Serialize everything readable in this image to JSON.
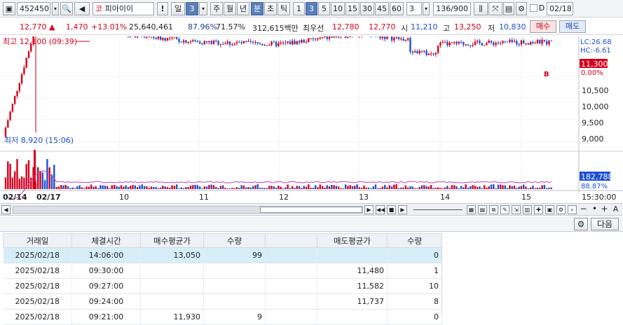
{
  "toolbar": {
    "stock_code": "452450",
    "market_tag": "코",
    "stock_name": "피아이이",
    "alert": "!",
    "period_buttons": [
      "일",
      "3",
      "주",
      "월",
      "년",
      "분",
      "초",
      "틱"
    ],
    "interval_buttons": [
      "1",
      "3",
      "5",
      "10",
      "15",
      "30",
      "45",
      "60"
    ],
    "interval_value": "3",
    "count_display": "136/900",
    "date_value": "02/18",
    "checkbox_label": "D"
  },
  "info": {
    "price": "12,770",
    "change": "1,470",
    "change_pct": "+13.01%",
    "volume": "25,640,461",
    "volume_ratio": "87.96%",
    "turnover": "71.57%",
    "trade_amount": "312,615백만",
    "best_ask_label": "최우선",
    "best_ask": "12,780",
    "best_bid": "12,770",
    "open_label": "시",
    "open": "11,210",
    "high_label": "고",
    "high": "13,250",
    "low_label": "저",
    "low": "10,830",
    "buy_label": "매수",
    "sell_label": "매도"
  },
  "chart": {
    "high_annotation": "최고 12,100 (09:39)",
    "low_annotation": "최저 8,920 (15:06)",
    "lc_label": "LC:26.68",
    "hc_label": "HC:-6.61",
    "price_label": "11,300",
    "pct_label": "0.00%",
    "b_marker": "B",
    "y_ticks": [
      "10,500",
      "10,000",
      "9,500",
      "9,000"
    ],
    "volume_value": "182,788",
    "volume_pct": "88.87%",
    "x_labels": [
      "02/14",
      "02/17",
      "10",
      "11",
      "12",
      "13",
      "14",
      "15"
    ],
    "time_label": "15:30:00",
    "colors": {
      "up": "#d6001c",
      "down": "#1c4fd6",
      "ma": "#c040c0"
    }
  },
  "chart_data": {
    "type": "line",
    "title": "",
    "xlabel": "",
    "ylabel": "",
    "x": [
      "02/14",
      "02/17",
      "10",
      "11",
      "12",
      "13",
      "14",
      "15"
    ],
    "ylim": [
      8800,
      11400
    ],
    "series": [
      {
        "values": [
          9100,
          11700,
          11500,
          11300,
          11250,
          11500,
          11250,
          11300
        ]
      }
    ]
  },
  "panel": {
    "next_label": "다음"
  },
  "table": {
    "headers": [
      "거래일",
      "체결시간",
      "매수평균가",
      "수량",
      "",
      "매도평균가",
      "수량"
    ],
    "rows": [
      [
        "2025/02/18",
        "14:06:00",
        "13,050",
        "99",
        "",
        "",
        "0"
      ],
      [
        "2025/02/18",
        "09:30:00",
        "",
        "",
        "",
        "11,480",
        "1"
      ],
      [
        "2025/02/18",
        "09:27:00",
        "",
        "",
        "",
        "11,582",
        "10"
      ],
      [
        "2025/02/18",
        "09:24:00",
        "",
        "",
        "",
        "11,737",
        "8"
      ],
      [
        "2025/02/18",
        "09:21:00",
        "11,930",
        "9",
        "",
        "",
        "0"
      ]
    ]
  }
}
